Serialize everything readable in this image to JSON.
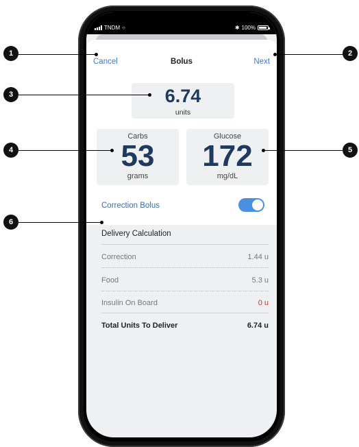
{
  "status_bar": {
    "carrier": "TNDM",
    "battery": "100%"
  },
  "nav": {
    "cancel": "Cancel",
    "title": "Bolus",
    "next": "Next"
  },
  "units": {
    "value": "6.74",
    "label": "units"
  },
  "carbs": {
    "label": "Carbs",
    "value": "53",
    "unit": "grams"
  },
  "glucose": {
    "label": "Glucose",
    "value": "172",
    "unit": "mg/dL"
  },
  "correction_bolus": {
    "label": "Correction Bolus",
    "enabled": true
  },
  "delivery": {
    "title": "Delivery Calculation",
    "rows": [
      {
        "label": "Correction",
        "value": "1.44 u"
      },
      {
        "label": "Food",
        "value": "5.3 u"
      },
      {
        "label": "Insulin On Board",
        "value": "0 u"
      }
    ],
    "total": {
      "label": "Total Units To Deliver",
      "value": "6.74 u"
    }
  },
  "callouts": [
    "1",
    "2",
    "3",
    "4",
    "5",
    "6"
  ],
  "colors": {
    "accent": "#3a7bd5",
    "value_navy": "#1f3a5f",
    "alert_red": "#c0392b",
    "toggle_on": "#4a90e2"
  }
}
